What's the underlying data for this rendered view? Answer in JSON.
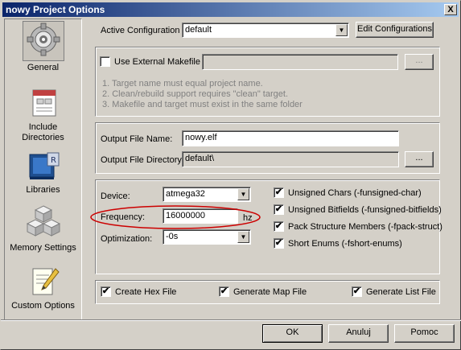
{
  "window": {
    "title": "nowy Project Options",
    "close_glyph": "X"
  },
  "nav": {
    "items": [
      {
        "label": "General",
        "icon": "gear-icon",
        "selected": true
      },
      {
        "label": "Include Directories",
        "icon": "include-directories-icon"
      },
      {
        "label": "Libraries",
        "icon": "libraries-icon"
      },
      {
        "label": "Memory Settings",
        "icon": "memory-blocks-icon"
      },
      {
        "label": "Custom Options",
        "icon": "custom-options-icon"
      }
    ]
  },
  "config": {
    "label": "Active Configuration",
    "value": "default",
    "edit_button": "Edit Configurations"
  },
  "makefile": {
    "checkbox_label": "Use External Makefile",
    "checked": false,
    "path_value": "",
    "browse_label": "...",
    "notes": [
      "1. Target name must equal project name.",
      "2. Clean/rebuild support requires \"clean\" target.",
      "3. Makefile and target must exist in the same folder"
    ]
  },
  "output": {
    "name_label": "Output File Name:",
    "name_value": "nowy.elf",
    "dir_label": "Output File Directory:",
    "dir_value": "default\\",
    "browse_label": "..."
  },
  "device": {
    "device_label": "Device:",
    "device_value": "atmega32",
    "freq_label": "Frequency:",
    "freq_value": "16000000",
    "freq_unit": "hz",
    "opt_label": "Optimization:",
    "opt_value": "-0s"
  },
  "flags": [
    {
      "label": "Unsigned Chars (-funsigned-char)",
      "checked": true
    },
    {
      "label": "Unsigned Bitfields (-funsigned-bitfields)",
      "checked": true
    },
    {
      "label": "Pack Structure Members (-fpack-struct)",
      "checked": true
    },
    {
      "label": "Short Enums (-fshort-enums)",
      "checked": true
    }
  ],
  "files": [
    {
      "label": "Create Hex File",
      "checked": true
    },
    {
      "label": "Generate Map File",
      "checked": true
    },
    {
      "label": "Generate List File",
      "checked": true
    }
  ],
  "buttons": {
    "ok": "OK",
    "cancel": "Anuluj",
    "help": "Pomoc"
  },
  "check_glyph": "✔",
  "colors": {
    "highlight_ellipse": "#cc0000",
    "title_start": "#0a246a",
    "title_end": "#a6caf0"
  }
}
